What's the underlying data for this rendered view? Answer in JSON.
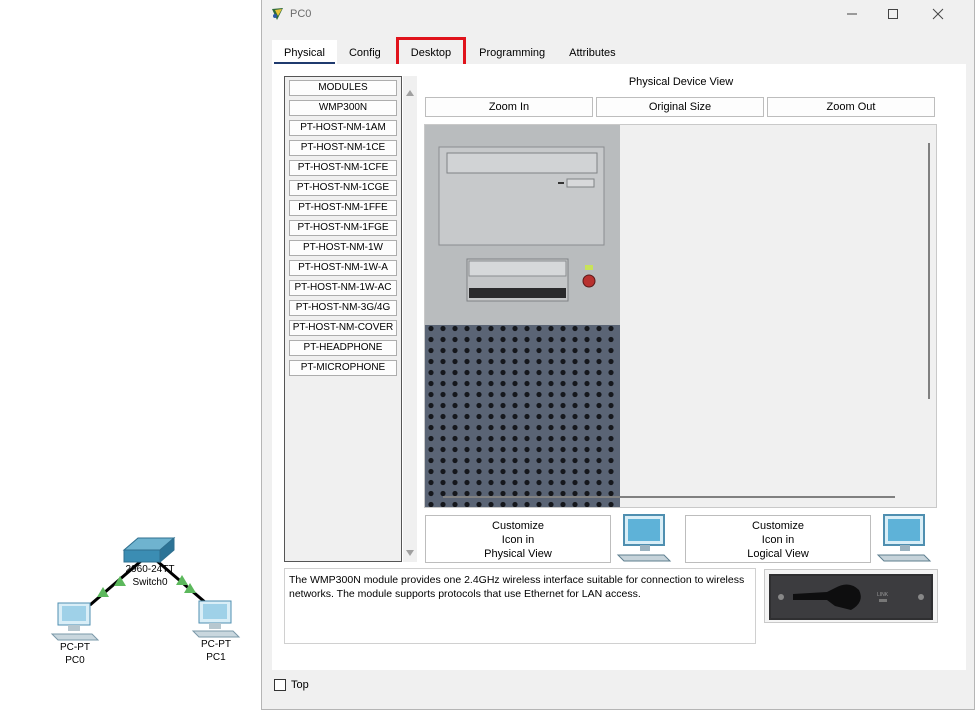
{
  "topology": {
    "switch": {
      "model": "2960-24TT",
      "name": "Switch0"
    },
    "pcs": [
      {
        "type": "PC-PT",
        "name": "PC0"
      },
      {
        "type": "PC-PT",
        "name": "PC1"
      }
    ]
  },
  "window": {
    "title": "PC0",
    "tabs": [
      "Physical",
      "Config",
      "Desktop",
      "Programming",
      "Attributes"
    ],
    "active_tab": "Physical",
    "highlighted_tab": "Desktop",
    "modules": [
      "MODULES",
      "WMP300N",
      "PT-HOST-NM-1AM",
      "PT-HOST-NM-1CE",
      "PT-HOST-NM-1CFE",
      "PT-HOST-NM-1CGE",
      "PT-HOST-NM-1FFE",
      "PT-HOST-NM-1FGE",
      "PT-HOST-NM-1W",
      "PT-HOST-NM-1W-A",
      "PT-HOST-NM-1W-AC",
      "PT-HOST-NM-3G/4G",
      "PT-HOST-NM-COVER",
      "PT-HEADPHONE",
      "PT-MICROPHONE"
    ],
    "physical_view_title": "Physical Device View",
    "zoom_in": "Zoom In",
    "original_size": "Original Size",
    "zoom_out": "Zoom Out",
    "customize_physical": "Customize\nIcon in\nPhysical View",
    "customize_logical": "Customize\nIcon in\nLogical View",
    "description": "The WMP300N module provides one 2.4GHz wireless interface suitable for connection to wireless networks. The module supports protocols that use Ethernet for LAN access.",
    "module_label": "LINK",
    "top_checkbox": "Top"
  },
  "colors": {
    "highlight": "#e0131b",
    "active_tab_underline": "#1f3a6e",
    "link_triangle": "#5cb85c"
  }
}
